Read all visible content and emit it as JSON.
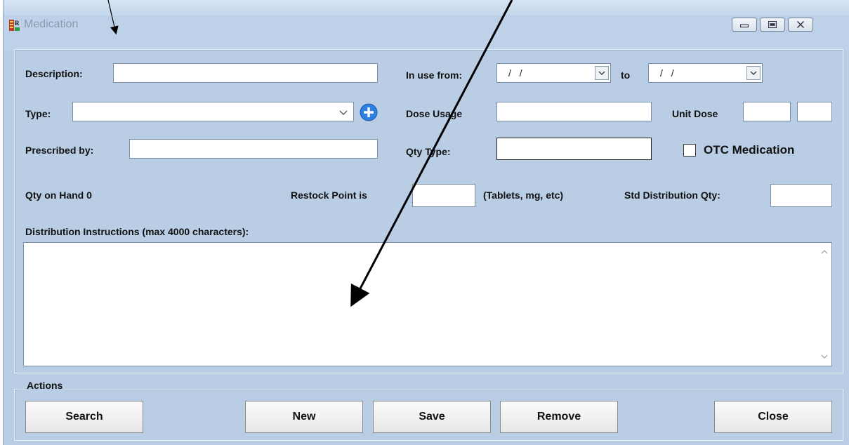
{
  "window": {
    "title": "Medication",
    "controls": [
      "minimize",
      "maximize",
      "close"
    ]
  },
  "form": {
    "description_label": "Description:",
    "description_value": "",
    "in_use_from_label": "In use from:",
    "in_use_from_value": "/  /",
    "to_label": "to",
    "in_use_to_value": "/  /",
    "type_label": "Type:",
    "type_value": "",
    "dose_usage_label": "Dose Usage",
    "dose_usage_value": "",
    "unit_dose_label": "Unit Dose",
    "unit_dose_value_1": "",
    "unit_dose_value_2": "",
    "prescribed_by_label": "Prescribed by:",
    "prescribed_by_value": "",
    "qty_type_label": "Qty Type:",
    "qty_type_value": "",
    "otc_label": "OTC Medication",
    "otc_checked": false,
    "qty_on_hand_label": "Qty on Hand 0",
    "restock_point_label": "Restock Point is",
    "restock_point_value": "",
    "restock_units_label": "(Tablets, mg, etc)",
    "std_distribution_label": "Std Distribution Qty:",
    "std_distribution_value": "",
    "instructions_label": "Distribution Instructions (max 4000 characters):",
    "instructions_value": ""
  },
  "actions": {
    "group_label": "Actions",
    "search_label": "Search",
    "new_label": "New",
    "save_label": "Save",
    "remove_label": "Remove",
    "close_label": "Close"
  },
  "colors": {
    "window_bg": "#b9cde4",
    "add_icon": "#2d7fe0",
    "annotation_arrow": "#000000"
  },
  "icons": [
    "medication-app-icon",
    "chevron-down-icon",
    "add-circle-icon",
    "scroll-up-icon",
    "scroll-down-icon"
  ]
}
